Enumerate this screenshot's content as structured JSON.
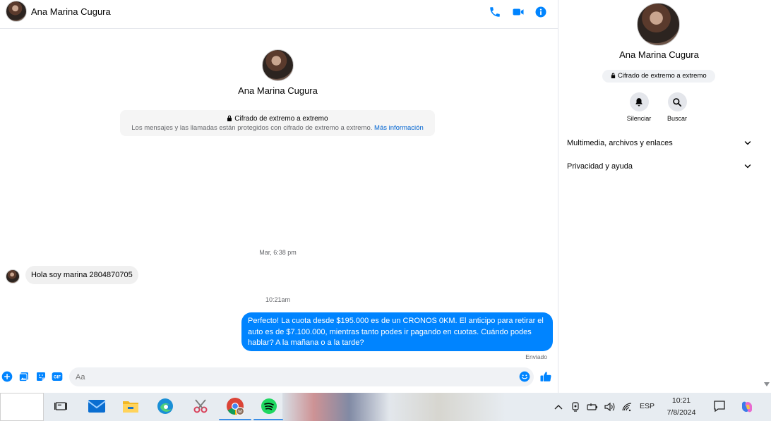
{
  "header": {
    "contact_name": "Ana Marina Cugura",
    "icons": [
      "phone-icon",
      "video-icon",
      "info-icon"
    ]
  },
  "intro": {
    "contact_name": "Ana Marina Cugura",
    "e2e_title": "Cifrado de extremo a extremo",
    "e2e_desc": "Los mensajes y las llamadas están protegidos con cifrado de extremo a extremo.",
    "e2e_link": "Más información"
  },
  "messages": [
    {
      "timestamp": "Mar, 6:38 pm"
    },
    {
      "direction": "incoming",
      "text": "Hola soy marina 2804870705"
    },
    {
      "timestamp": "10:21am"
    },
    {
      "direction": "outgoing",
      "text": "Perfecto! La cuota desde $195.000 es de un CRONOS 0KM. El anticipo para retirar el auto es de $7.100.000, mientras tanto podes ir pagando en cuotas. Cuándo podes hablar? A la mañana o a la tarde?",
      "status": "Enviado"
    }
  ],
  "composer": {
    "placeholder": "Aa",
    "gif_label": "GIF"
  },
  "info_pane": {
    "contact_name": "Ana Marina Cugura",
    "e2e_badge": "Cifrado de extremo a extremo",
    "actions": [
      {
        "label": "Silenciar",
        "icon": "bell-icon"
      },
      {
        "label": "Buscar",
        "icon": "search-icon"
      }
    ],
    "sections": [
      {
        "label": "Multimedia, archivos y enlaces"
      },
      {
        "label": "Privacidad y ayuda"
      }
    ]
  },
  "taskbar": {
    "apps": [
      "task-view-icon",
      "mail-icon",
      "file-explorer-icon",
      "edge-icon",
      "snipping-tool-icon",
      "chrome-icon",
      "spotify-icon"
    ],
    "language": "ESP",
    "time": "10:21",
    "date": "7/8/2024"
  },
  "colors": {
    "accent": "#0084ff",
    "link": "#0064d1",
    "bubble_incoming": "#f0f0f0"
  }
}
